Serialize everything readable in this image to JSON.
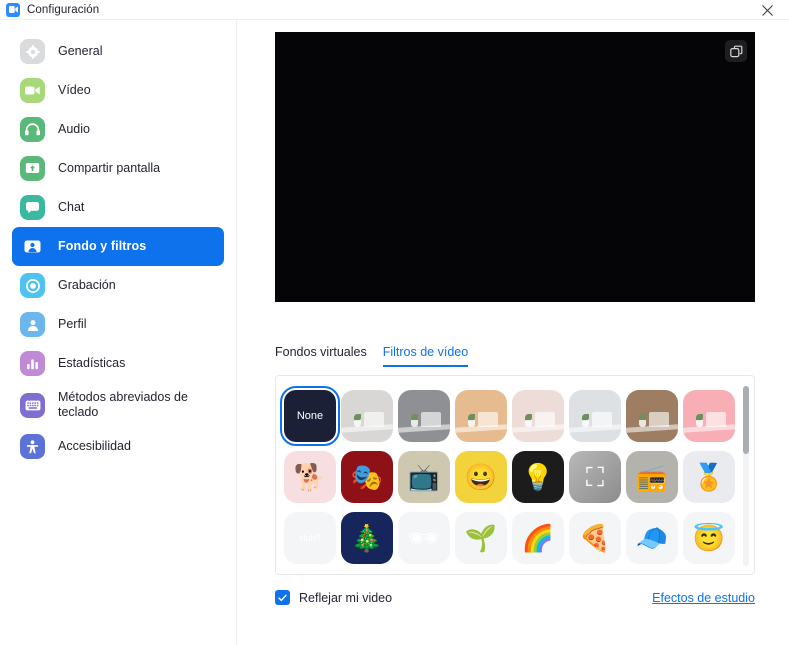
{
  "window": {
    "title": "Configuración",
    "app_icon": "zoom-logo-icon",
    "close_icon": "close-icon"
  },
  "sidebar": {
    "items": [
      {
        "label": "General",
        "icon": "gear-icon",
        "color": "#d9dbdd",
        "active": false
      },
      {
        "label": "Vídeo",
        "icon": "video-camera-icon",
        "color": "#a7d97a",
        "active": false
      },
      {
        "label": "Audio",
        "icon": "headphones-icon",
        "color": "#58b978",
        "active": false
      },
      {
        "label": "Compartir pantalla",
        "icon": "screen-share-icon",
        "color": "#5cb87a",
        "active": false
      },
      {
        "label": "Chat",
        "icon": "chat-bubble-icon",
        "color": "#3bb8a0",
        "active": false
      },
      {
        "label": "Fondo y filtros",
        "icon": "person-frame-icon",
        "color": "#0e72ed",
        "active": true
      },
      {
        "label": "Grabación",
        "icon": "record-circle-icon",
        "color": "#4ec3f0",
        "active": false
      },
      {
        "label": "Perfil",
        "icon": "person-icon",
        "color": "#6cb6ee",
        "active": false
      },
      {
        "label": "Estadísticas",
        "icon": "bar-chart-icon",
        "color": "#c08ad6",
        "active": false
      },
      {
        "label": "Métodos abreviados de teclado",
        "icon": "keyboard-icon",
        "color": "#7e6fd0",
        "active": false
      },
      {
        "label": "Accesibilidad",
        "icon": "accessibility-icon",
        "color": "#5b72d6",
        "active": false
      }
    ]
  },
  "preview": {
    "snapshot_icon": "snapshot-icon",
    "background": "#050507"
  },
  "tabs": [
    {
      "label": "Fondos virtuales",
      "active": false
    },
    {
      "label": "Filtros de vídeo",
      "active": true
    }
  ],
  "filters": {
    "selected_index": 0,
    "items": [
      {
        "name": "None",
        "label": "None",
        "kind": "none",
        "bg": "#1b2036"
      },
      {
        "name": "gris-claro",
        "label": "",
        "kind": "scene",
        "bg": "#d8d7d5"
      },
      {
        "name": "gris-medio",
        "label": "",
        "kind": "scene",
        "bg": "#8f9093"
      },
      {
        "name": "durazno",
        "label": "",
        "kind": "scene",
        "bg": "#e6bb8f"
      },
      {
        "name": "rosa-palido",
        "label": "",
        "kind": "scene",
        "bg": "#eddcd8"
      },
      {
        "name": "azul-grisaceo",
        "label": "",
        "kind": "scene",
        "bg": "#dde1e4"
      },
      {
        "name": "marron",
        "label": "",
        "kind": "scene",
        "bg": "#9d7e63"
      },
      {
        "name": "rosa-intenso",
        "label": "",
        "kind": "scene",
        "bg": "#f7aeb4"
      },
      {
        "name": "perro-corgi",
        "label": "🐕",
        "kind": "art",
        "bg": "#f7dfe1"
      },
      {
        "name": "cortinas-teatro",
        "label": "🎭",
        "kind": "art",
        "bg": "#8e1118"
      },
      {
        "name": "tv-retro",
        "label": "📺",
        "kind": "art",
        "bg": "#cfc8b0"
      },
      {
        "name": "marco-emojis",
        "label": "😀",
        "kind": "art",
        "bg": "#f3d33c"
      },
      {
        "name": "luces-camerino",
        "label": "💡",
        "kind": "art",
        "bg": "#1c1c1c"
      },
      {
        "name": "marco-enfoque",
        "label": "⛶",
        "kind": "art",
        "bg": "#9b9b9b"
      },
      {
        "name": "tv-vintage",
        "label": "📻",
        "kind": "art",
        "bg": "#b4b2ad"
      },
      {
        "name": "escarapela",
        "label": "🏅",
        "kind": "art",
        "bg": "#e9ebee"
      },
      {
        "name": "globo-huh",
        "label": "Huh?",
        "kind": "bubble",
        "bg": "#f4f5f7"
      },
      {
        "name": "luces-navidad",
        "label": "🎄",
        "kind": "art",
        "bg": "#16265c"
      },
      {
        "name": "gafas-pixel",
        "label": "🕶",
        "kind": "face",
        "bg": "#f4f5f7"
      },
      {
        "name": "brote-kawaii",
        "label": "🌱",
        "kind": "face",
        "bg": "#f4f5f7"
      },
      {
        "name": "arcoiris",
        "label": "🌈",
        "kind": "face",
        "bg": "#f4f5f7"
      },
      {
        "name": "pizza",
        "label": "🍕",
        "kind": "face",
        "bg": "#f4f5f7"
      },
      {
        "name": "gorra",
        "label": "🧢",
        "kind": "face",
        "bg": "#f4f5f7"
      },
      {
        "name": "aureola",
        "label": "😇",
        "kind": "face",
        "bg": "#f4f5f7"
      }
    ],
    "scrollbar": {
      "position": "top",
      "thumb_ratio": 0.38
    }
  },
  "bottom": {
    "mirror_label": "Reflejar mi video",
    "mirror_checked": true,
    "studio_effects_label": "Efectos de estudio",
    "accent_color": "#0e72ed"
  }
}
